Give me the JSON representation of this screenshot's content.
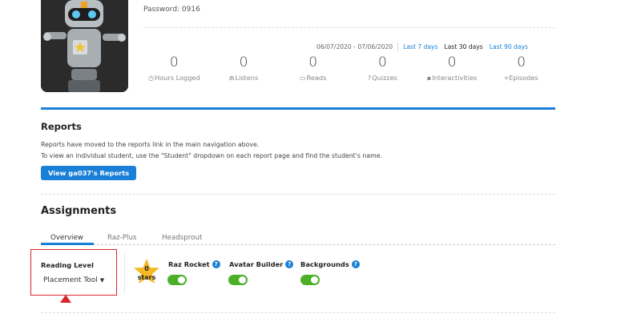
{
  "profile": {
    "password": "Password: 0916"
  },
  "date_range": {
    "text": "06/07/2020 - 07/06/2020",
    "links": [
      "Last 7 days",
      "Last 30 days",
      "Last 90 days"
    ],
    "active": "Last 30 days"
  },
  "stats": [
    {
      "value": "0",
      "label": "Hours Logged",
      "icon": "clock-icon",
      "glyph": "◷"
    },
    {
      "value": "0",
      "label": "Listens",
      "icon": "headphones-icon",
      "glyph": "⋒"
    },
    {
      "value": "0",
      "label": "Reads",
      "icon": "book-icon",
      "glyph": "▭"
    },
    {
      "value": "0",
      "label": "Quizzes",
      "icon": "question-icon",
      "glyph": "?"
    },
    {
      "value": "0",
      "label": "Interactivities",
      "icon": "interactive-icon",
      "glyph": "▪"
    },
    {
      "value": "0",
      "label": "Episodes",
      "icon": "episodes-icon",
      "glyph": "⌗"
    }
  ],
  "reports": {
    "title": "Reports",
    "line1": "Reports have moved to the reports link in the main navigation above.",
    "line2": "To view an individual student, use the \"Student\" dropdown on each report page and find the student's name.",
    "button": "View ga037's Reports"
  },
  "assignments": {
    "title": "Assignments",
    "tabs": [
      "Overview",
      "Raz-Plus",
      "Headsprout"
    ],
    "active_tab": "Overview",
    "reading_level_label": "Reading Level",
    "reading_level_value": "Placement Tool",
    "stars_count": "0",
    "stars_label": "stars",
    "features": [
      {
        "label": "Raz Rocket",
        "enabled": true
      },
      {
        "label": "Avatar Builder",
        "enabled": true
      },
      {
        "label": "Backgrounds",
        "enabled": true
      }
    ]
  },
  "colors": {
    "accent": "#1a7fd6",
    "toggle_on": "#4caf28",
    "highlight": "#d9262b"
  }
}
